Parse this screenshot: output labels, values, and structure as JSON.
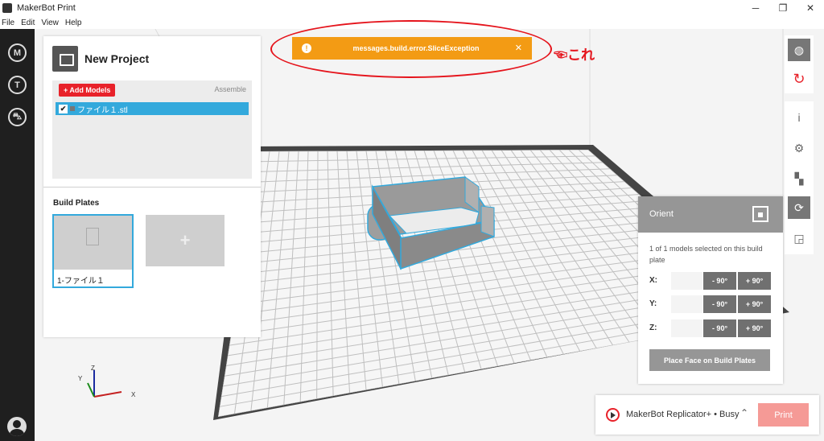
{
  "window": {
    "title": "MakerBot Print",
    "minimize": "─",
    "maximize": "❐",
    "close": "✕"
  },
  "menu": {
    "items": [
      "File",
      "Edit",
      "View",
      "Help"
    ]
  },
  "rail": {
    "items": [
      {
        "icon": "makerbot-logo-icon",
        "glyph": "M"
      },
      {
        "icon": "thingiverse-icon",
        "glyph": "T"
      },
      {
        "icon": "cart-icon",
        "glyph": "⛍"
      }
    ]
  },
  "project": {
    "title": "New Project",
    "add_models_label": "+ Add Models",
    "assemble_label": "Assemble",
    "models": [
      {
        "name": "ファイル１.stl",
        "checked": true
      }
    ],
    "build_plates_title": "Build Plates",
    "plates": [
      {
        "label": "1-ファイル１"
      }
    ],
    "add_plate_glyph": "+"
  },
  "toast": {
    "message": "messages.build.error.SliceException",
    "icon_glyph": "!",
    "close_glyph": "✕",
    "color": "#f39b14"
  },
  "annotation": {
    "text": "☜これ",
    "color": "#e5141c"
  },
  "axes_gizmo": {
    "x": "X",
    "y": "Y",
    "z": "Z"
  },
  "orient": {
    "title": "Orient",
    "description": "1 of 1 models selected on this build plate",
    "axes": [
      {
        "label": "X:",
        "minus": "- 90°",
        "plus": "+ 90°"
      },
      {
        "label": "Y:",
        "minus": "- 90°",
        "plus": "+ 90°"
      },
      {
        "label": "Z:",
        "minus": "- 90°",
        "plus": "+ 90°"
      }
    ],
    "place_face_label": "Place Face on Build Plates"
  },
  "printer": {
    "name": "MakerBot Replicator+ • Busy",
    "chevron": "⌃",
    "print_label": "Print"
  },
  "toolbar": {
    "view_icon": "view-sphere-icon",
    "reset_icon": "reset-icon",
    "info_glyph": "i",
    "settings_glyph": "⚙",
    "arrange_glyph": "▚",
    "orient_glyph": "⟳",
    "scale_glyph": "◲"
  },
  "colors": {
    "accent_blue": "#33a9dc",
    "brand_red": "#e8222a",
    "print_button": "#f59a96"
  }
}
